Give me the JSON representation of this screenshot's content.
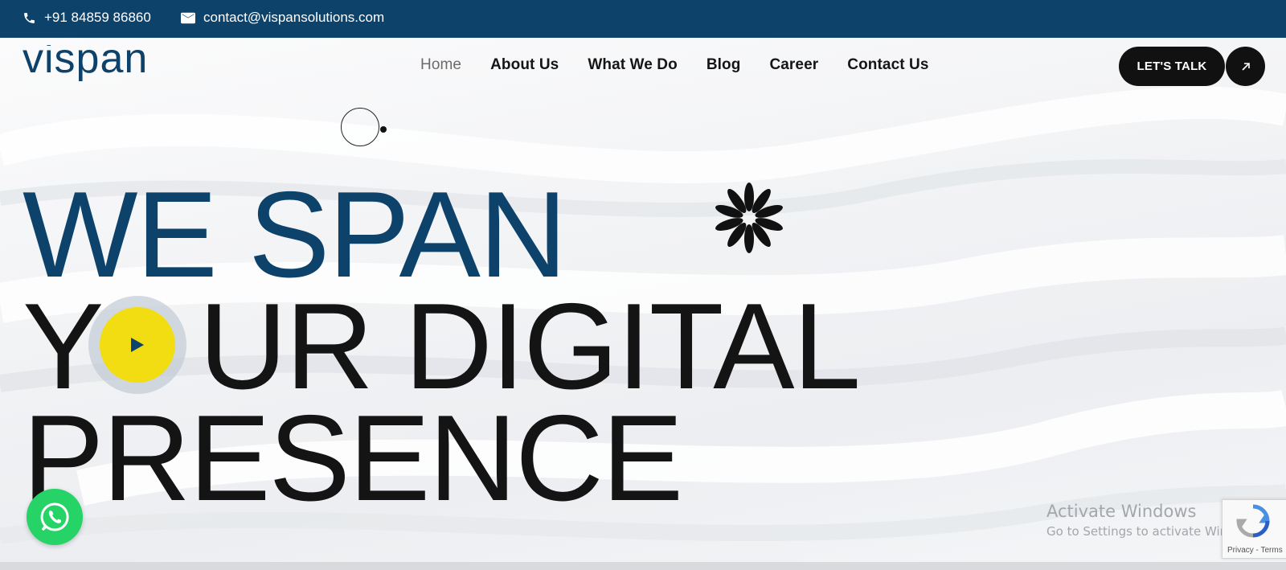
{
  "topbar": {
    "phone": "+91 84859 86860",
    "email": "contact@vispansolutions.com",
    "background": "#0d426b"
  },
  "header": {
    "logo_text": "vispan",
    "nav": [
      {
        "label": "Home",
        "active": true
      },
      {
        "label": "About Us",
        "active": false
      },
      {
        "label": "What We Do",
        "active": false
      },
      {
        "label": "Blog",
        "active": false
      },
      {
        "label": "Career",
        "active": false
      },
      {
        "label": "Contact Us",
        "active": false
      }
    ],
    "cta_label": "LET'S TALK"
  },
  "hero": {
    "line1": "WE SPAN",
    "line2_pre": "Y",
    "line2_post": "UR DIGITAL",
    "line3": "PRESENCE",
    "accent_color": "#0d426b",
    "play_button_color": "#f2dd12"
  },
  "overlay": {
    "activate_title": "Activate Windows",
    "activate_sub": "Go to Settings to activate Windows.",
    "recaptcha_text": "Privacy - Terms"
  },
  "icons": [
    "phone-icon",
    "mail-icon",
    "arrow-up-right-icon",
    "play-icon",
    "asterisk-icon",
    "whatsapp-icon",
    "recaptcha-icon"
  ]
}
